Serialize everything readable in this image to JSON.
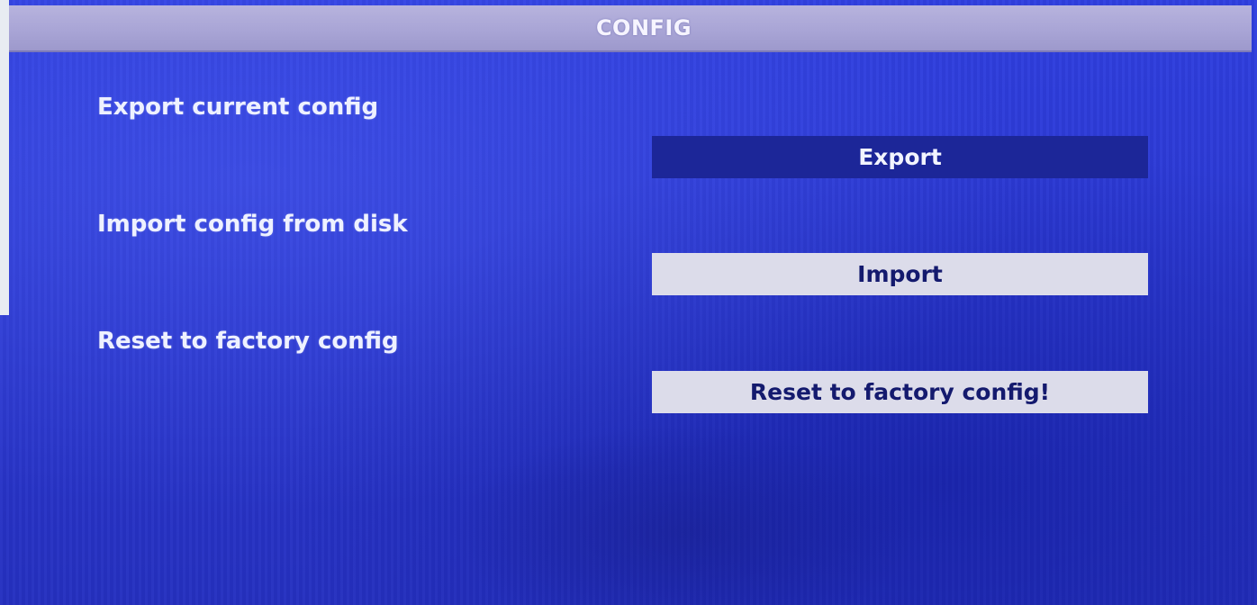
{
  "window": {
    "title": "CONFIG"
  },
  "rows": [
    {
      "label": "Export current config",
      "button": "Export"
    },
    {
      "label": "Import config from disk",
      "button": "Import"
    },
    {
      "label": "Reset to factory config",
      "button": "Reset to factory config!"
    }
  ],
  "colors": {
    "background": "#2d3cd2",
    "titlebar": "#aba7d8",
    "selected_button": "#1c2698",
    "button": "#dcdcea"
  },
  "state": {
    "focused_button": "Export"
  }
}
